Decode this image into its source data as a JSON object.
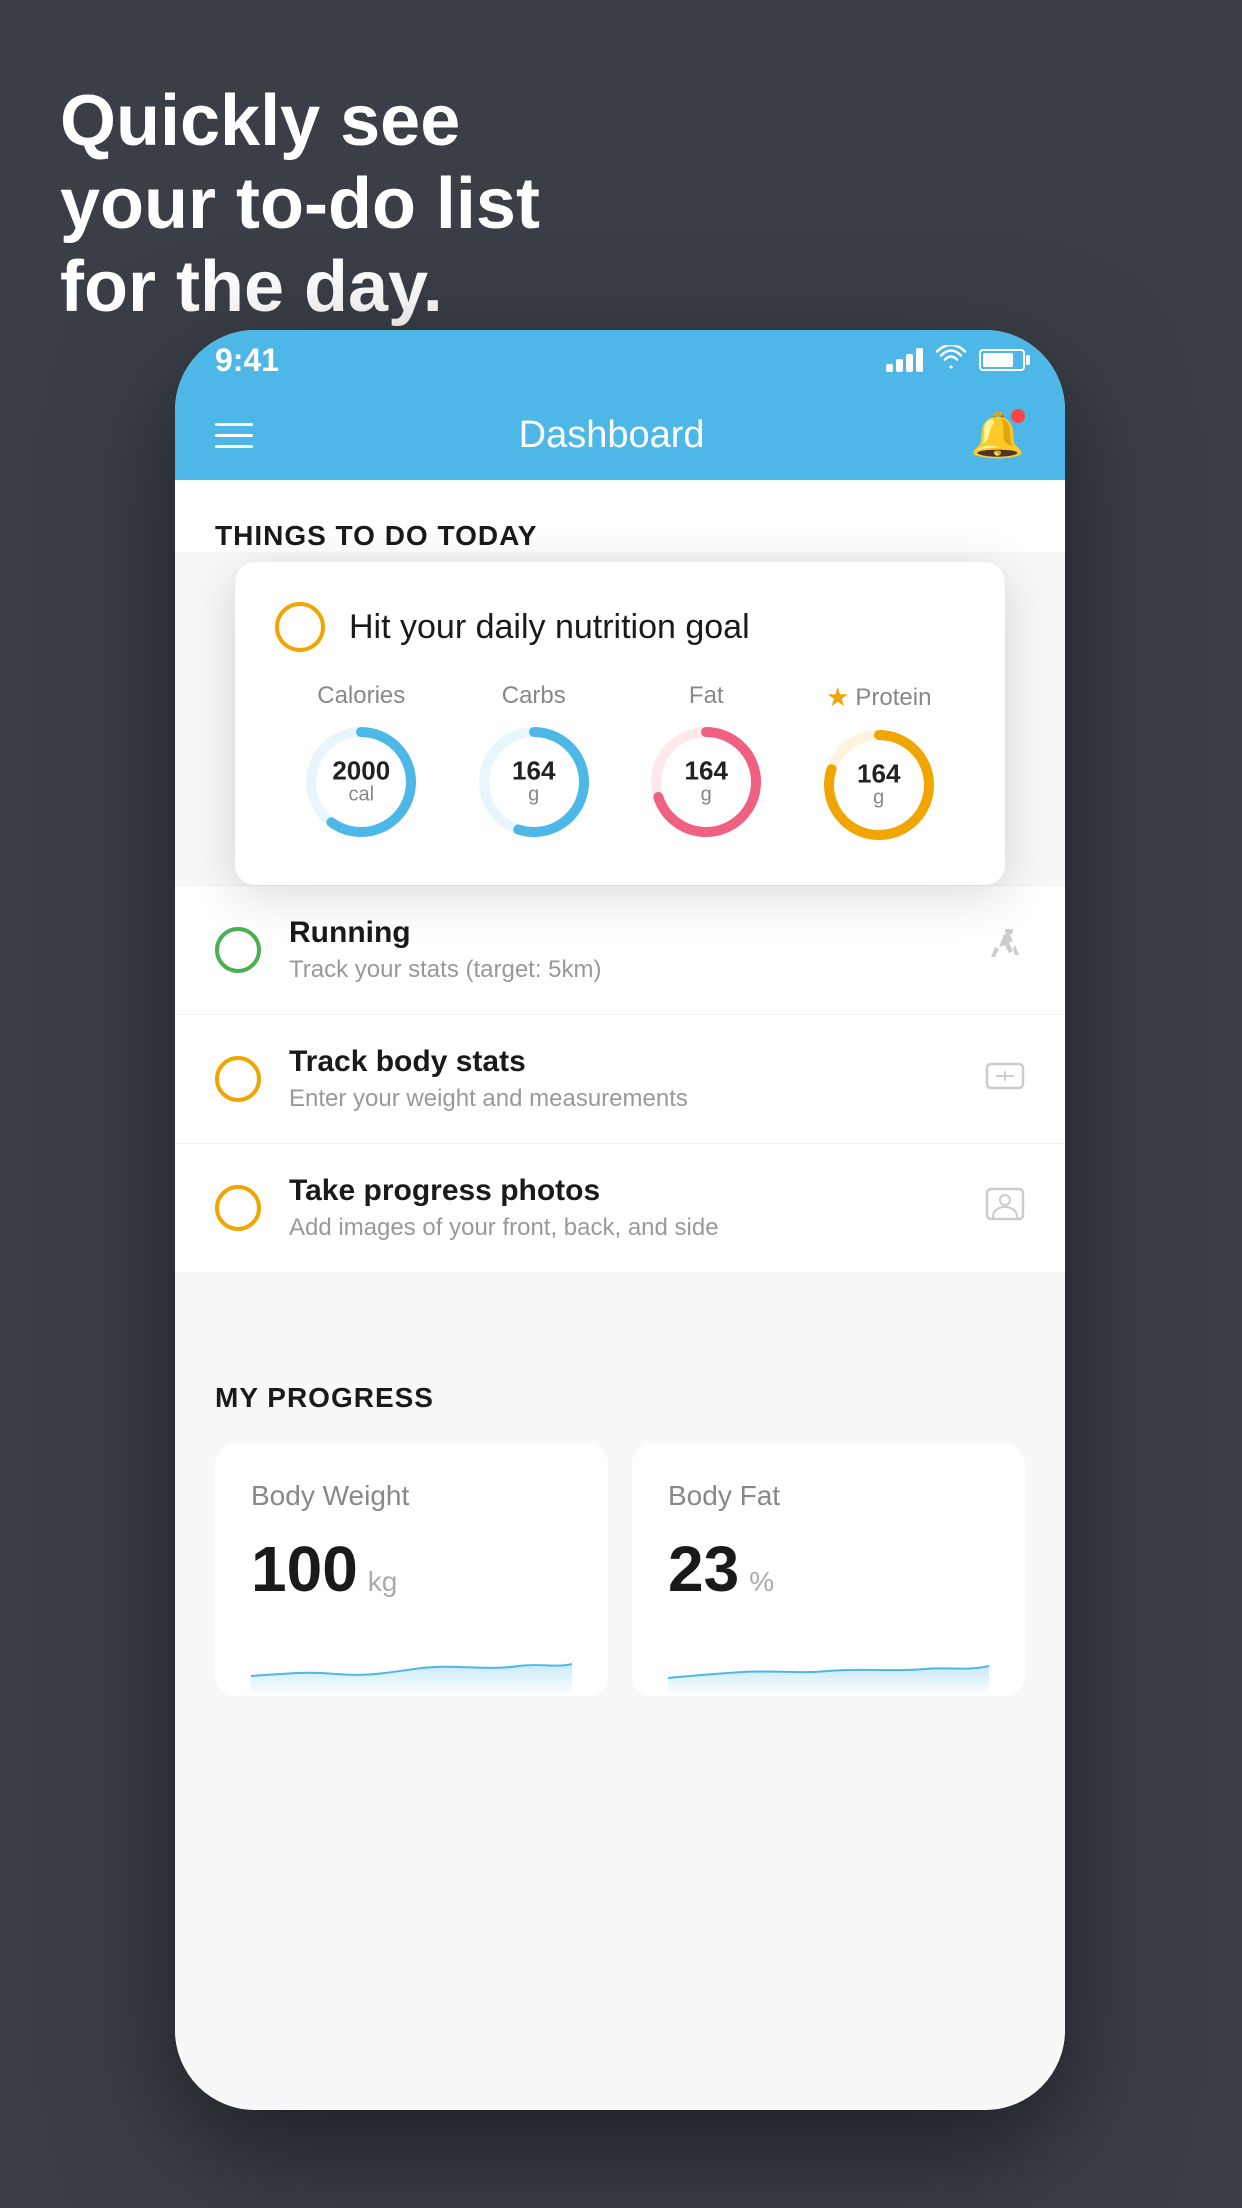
{
  "headline": {
    "line1": "Quickly see",
    "line2": "your to-do list",
    "line3": "for the day."
  },
  "status_bar": {
    "time": "9:41",
    "signal_title": "signal",
    "wifi_title": "wifi",
    "battery_title": "battery"
  },
  "header": {
    "title": "Dashboard",
    "hamburger_label": "menu",
    "bell_label": "notifications"
  },
  "things_section": {
    "header": "THINGS TO DO TODAY"
  },
  "nutrition_card": {
    "title": "Hit your daily nutrition goal",
    "items": [
      {
        "label": "Calories",
        "value": "2000",
        "unit": "cal",
        "color": "#4db8e8",
        "percent": 60
      },
      {
        "label": "Carbs",
        "value": "164",
        "unit": "g",
        "color": "#4db8e8",
        "percent": 55
      },
      {
        "label": "Fat",
        "value": "164",
        "unit": "g",
        "color": "#f06080",
        "percent": 70
      },
      {
        "label": "Protein",
        "value": "164",
        "unit": "g",
        "color": "#f0a500",
        "percent": 80,
        "starred": true
      }
    ]
  },
  "todo_items": [
    {
      "title": "Running",
      "subtitle": "Track your stats (target: 5km)",
      "circle_color": "green",
      "icon": "👟"
    },
    {
      "title": "Track body stats",
      "subtitle": "Enter your weight and measurements",
      "circle_color": "yellow",
      "icon": "⚖️"
    },
    {
      "title": "Take progress photos",
      "subtitle": "Add images of your front, back, and side",
      "circle_color": "yellow",
      "icon": "👤"
    }
  ],
  "progress_section": {
    "header": "MY PROGRESS",
    "cards": [
      {
        "title": "Body Weight",
        "value": "100",
        "unit": "kg"
      },
      {
        "title": "Body Fat",
        "value": "23",
        "unit": "%"
      }
    ]
  }
}
